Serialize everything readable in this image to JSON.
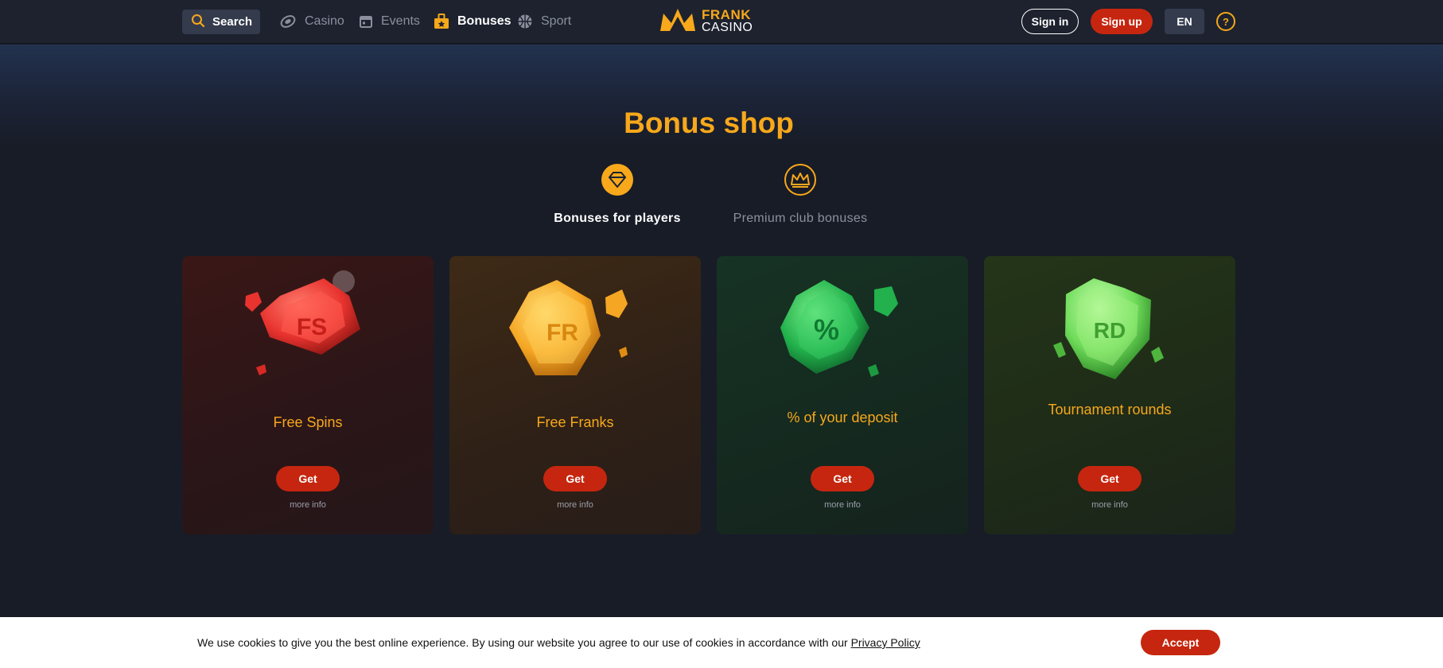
{
  "header": {
    "search_label": "Search",
    "nav": [
      {
        "label": "Casino",
        "icon": "casino-chip-icon"
      },
      {
        "label": "Events",
        "icon": "calendar-icon"
      },
      {
        "label": "Bonuses",
        "icon": "gift-icon"
      },
      {
        "label": "Sport",
        "icon": "ball-icon"
      }
    ],
    "logo": {
      "line1": "FRANK",
      "line2": "CASINO"
    },
    "signin_label": "Sign in",
    "signup_label": "Sign up",
    "lang_label": "EN",
    "help_label": "?"
  },
  "main": {
    "title": "Bonus shop",
    "tabs": [
      {
        "label": "Bonuses for players",
        "icon": "diamond-icon",
        "active": true
      },
      {
        "label": "Premium club bonuses",
        "icon": "crown-icon",
        "active": false
      }
    ],
    "cards": [
      {
        "badge": "FS",
        "name": "Free Spins",
        "button": "Get",
        "more": "more info",
        "color": "#e8332f"
      },
      {
        "badge": "FR",
        "name": "Free Franks",
        "button": "Get",
        "more": "more info",
        "color": "#f5a623"
      },
      {
        "badge": "%",
        "name": "% of your deposit",
        "button": "Get",
        "more": "more info",
        "color": "#22b14c"
      },
      {
        "badge": "RD",
        "name": "Tournament rounds",
        "button": "Get",
        "more": "more info",
        "color": "#6fdc5a"
      }
    ]
  },
  "cookie": {
    "text": "We use cookies to give you the best online experience. By using our website you agree to our use of cookies in accordance with our",
    "link": "Privacy Policy",
    "accept": "Accept"
  },
  "colors": {
    "accent": "#f7a81b",
    "primary_button": "#c6260f",
    "background": "#181c27",
    "header": "#1d222e"
  }
}
